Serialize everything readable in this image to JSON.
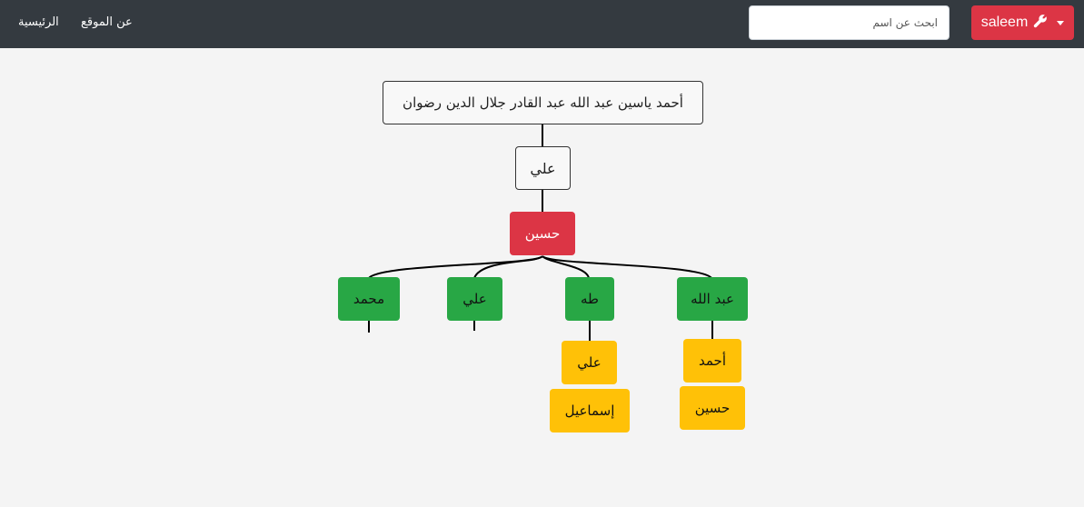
{
  "navbar": {
    "home_label": "الرئيسية",
    "about_label": "عن الموقع",
    "search_placeholder": "ابحث عن اسم",
    "user_label": "saleem",
    "user_icon": "wrench-icon",
    "accent_color": "#dc3545"
  },
  "tree": {
    "root": "أحمد ياسين عبد الله عبد القادر جلال الدين رضوان",
    "father": "علي",
    "selected": "حسين",
    "children": [
      {
        "name": "محمد",
        "children": []
      },
      {
        "name": "علي",
        "children": []
      },
      {
        "name": "طه",
        "children": [
          "علي",
          "إسماعيل"
        ]
      },
      {
        "name": "عبد الله",
        "children": [
          "أحمد",
          "حسين"
        ]
      }
    ],
    "colors": {
      "ancestor": "#f8f8f8",
      "selected": "#dc3545",
      "child": "#28a745",
      "grandchild": "#ffc107"
    }
  }
}
